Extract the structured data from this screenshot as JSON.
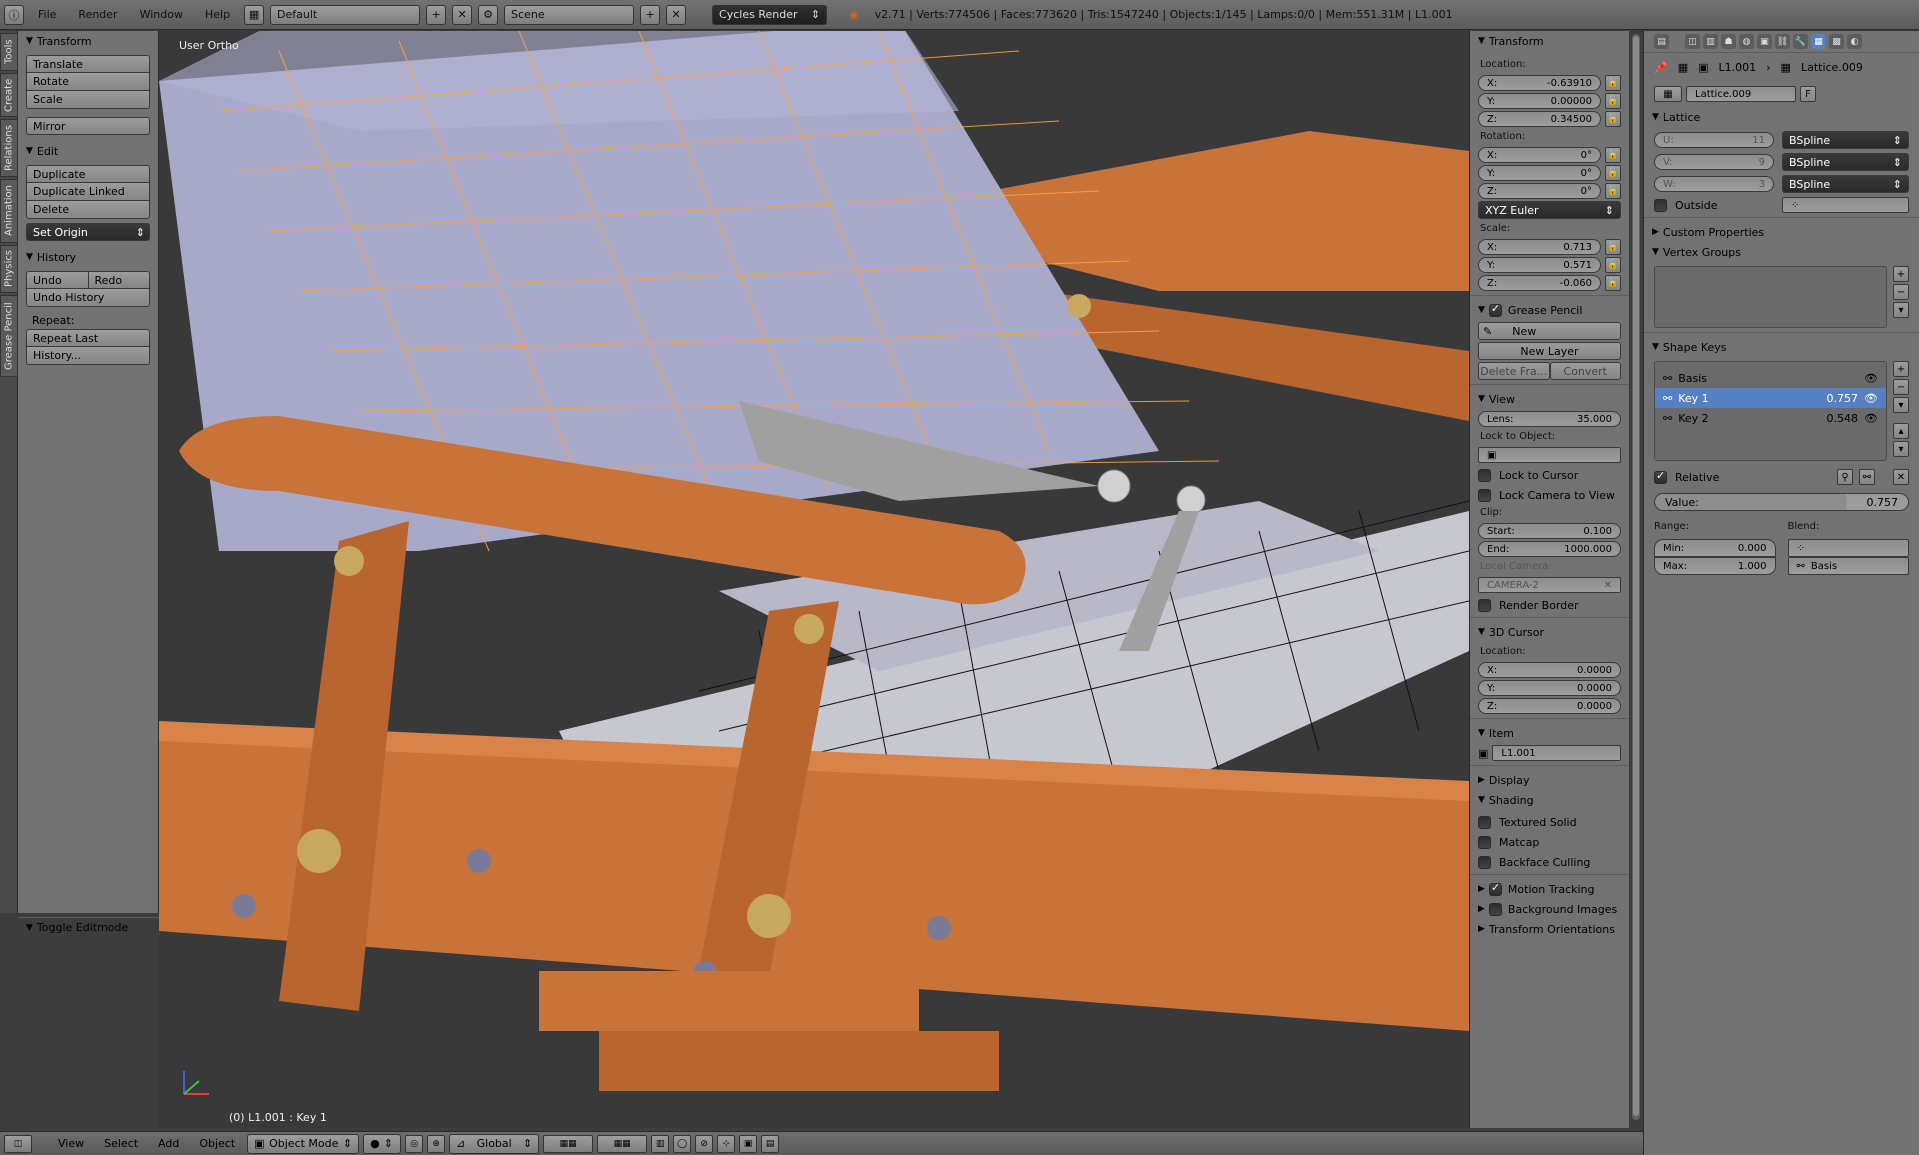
{
  "topbar": {
    "menus": [
      "File",
      "Render",
      "Window",
      "Help"
    ],
    "layout": "Default",
    "scene": "Scene",
    "engine": "Cycles Render",
    "stats": "v2.71 | Verts:774506 | Faces:773620 | Tris:1547240 | Objects:1/145 | Lamps:0/0 | Mem:551.31M | L1.001"
  },
  "sidetabs": [
    "Tools",
    "Create",
    "Relations",
    "Animation",
    "Physics",
    "Grease Pencil"
  ],
  "toolshelf": {
    "transform_header": "Transform",
    "translate": "Translate",
    "rotate": "Rotate",
    "scale": "Scale",
    "mirror": "Mirror",
    "edit_header": "Edit",
    "duplicate": "Duplicate",
    "duplicate_linked": "Duplicate Linked",
    "delete": "Delete",
    "set_origin": "Set Origin",
    "history_header": "History",
    "undo": "Undo",
    "redo": "Redo",
    "undo_history": "Undo History",
    "repeat_label": "Repeat:",
    "repeat_last": "Repeat Last",
    "history": "History...",
    "toggle_editmode": "Toggle Editmode"
  },
  "viewport": {
    "view_label": "User Ortho",
    "object_label": "(0) L1.001 : Key 1"
  },
  "npanel": {
    "transform_header": "Transform",
    "location_label": "Location:",
    "loc_x": "-0.63910",
    "loc_y": "0.00000",
    "loc_z": "0.34500",
    "rotation_label": "Rotation:",
    "rot_x": "0°",
    "rot_y": "0°",
    "rot_z": "0°",
    "rotation_mode": "XYZ Euler",
    "scale_label": "Scale:",
    "scale_x": "0.713",
    "scale_y": "0.571",
    "scale_z": "-0.060",
    "grease_pencil_header": "Grease Pencil",
    "gp_new": "New",
    "gp_new_layer": "New Layer",
    "gp_delete_frame": "Delete Fra...",
    "gp_convert": "Convert",
    "view_header": "View",
    "lens_label": "Lens:",
    "lens_value": "35.000",
    "lock_to_object": "Lock to Object:",
    "lock_to_cursor": "Lock to Cursor",
    "lock_camera_to_view": "Lock Camera to View",
    "clip_label": "Clip:",
    "clip_start_label": "Start:",
    "clip_start": "0.100",
    "clip_end_label": "End:",
    "clip_end": "1000.000",
    "local_camera": "Local Camera:",
    "camera_name": "CAMERA-2",
    "render_border": "Render Border",
    "cursor_header": "3D Cursor",
    "cursor_location": "Location:",
    "cursor_x": "0.0000",
    "cursor_y": "0.0000",
    "cursor_z": "0.0000",
    "item_header": "Item",
    "item_name": "L1.001",
    "display_header": "Display",
    "shading_header": "Shading",
    "textured_solid": "Textured Solid",
    "matcap": "Matcap",
    "backface_culling": "Backface Culling",
    "motion_tracking": "Motion Tracking",
    "background_images": "Background Images",
    "transform_orientations": "Transform Orientations"
  },
  "props": {
    "breadcrumb_object": "L1.001",
    "breadcrumb_data": "Lattice.009",
    "datablock": "Lattice.009",
    "fake_user": "F",
    "lattice_header": "Lattice",
    "u_label": "U:",
    "u_value": "11",
    "v_label": "V:",
    "v_value": "9",
    "w_label": "W:",
    "w_value": "3",
    "interp_u": "BSpline",
    "interp_v": "BSpline",
    "interp_w": "BSpline",
    "outside": "Outside",
    "custom_properties": "Custom Properties",
    "vertex_groups": "Vertex Groups",
    "shape_keys": "Shape Keys",
    "keys": [
      {
        "name": "Basis",
        "value": ""
      },
      {
        "name": "Key 1",
        "value": "0.757"
      },
      {
        "name": "Key 2",
        "value": "0.548"
      }
    ],
    "relative": "Relative",
    "value_label": "Value:",
    "value": "0.757",
    "range_label": "Range:",
    "blend_label": "Blend:",
    "min_label": "Min:",
    "min_value": "0.000",
    "max_label": "Max:",
    "max_value": "1.000",
    "blend_value": "Basis"
  },
  "bottombar": {
    "menus": [
      "View",
      "Select",
      "Add",
      "Object"
    ],
    "mode": "Object Mode",
    "orientation": "Global"
  },
  "colors": {
    "wood": "#c8733a",
    "cushion": "#a8a8c8",
    "selection": "#5680c2",
    "lattice": "#ff9f40"
  }
}
